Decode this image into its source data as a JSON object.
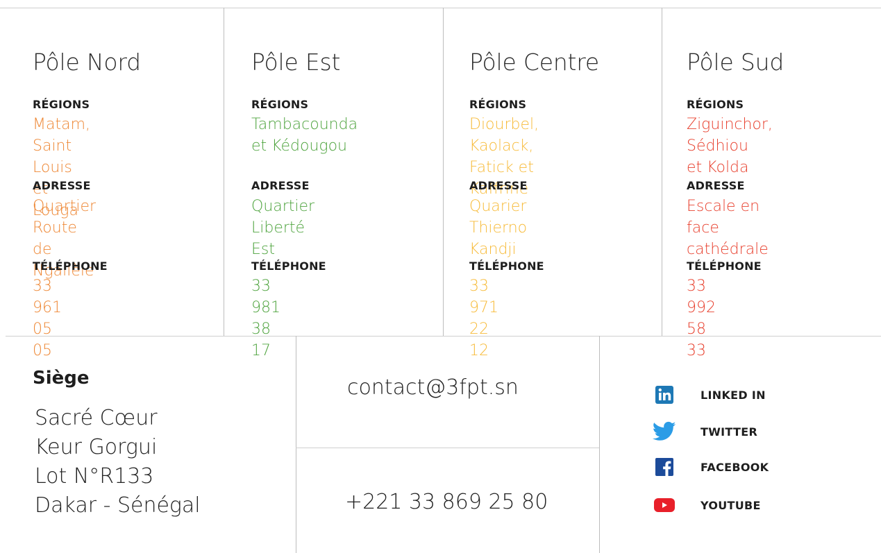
{
  "poles": [
    {
      "title": "Pôle Nord",
      "color": "#ee8836",
      "regions_label": "RÉGIONS",
      "regions": "Matam, Saint Louis\net Louga",
      "adresse_label": "ADRESSE",
      "adresse": "Quartier Route\nde Ngallèle",
      "telephone_label": "TÉLÉPHONE",
      "telephone": "33 961 05 05"
    },
    {
      "title": "Pôle Est",
      "color": "#4fa43f",
      "regions_label": "RÉGIONS",
      "regions": "Tambacounda\net Kédougou",
      "adresse_label": "ADRESSE",
      "adresse": "Quartier Liberté\nEst",
      "telephone_label": "TÉLÉPHONE",
      "telephone": "33 981 38 17"
    },
    {
      "title": "Pôle Centre",
      "color": "#f7bb3a",
      "regions_label": "RÉGIONS",
      "regions": "Diourbel, Kaolack,\nFatick et Kaffrine",
      "adresse_label": "ADRESSE",
      "adresse": "Quarier Thierno\nKandji",
      "telephone_label": "TÉLÉPHONE",
      "telephone": "33 971 22 12"
    },
    {
      "title": "Pôle Sud",
      "color": "#e8412f",
      "regions_label": "RÉGIONS",
      "regions": "Ziguinchor, Sédhiou\net Kolda",
      "adresse_label": "ADRESSE",
      "adresse": "Escale en face\ncathédrale",
      "telephone_label": "TÉLÉPHONE",
      "telephone": "33 992 58 33"
    }
  ],
  "siege": {
    "title": "Siège",
    "lines": [
      "Sacré Cœur",
      "Keur Gorgui",
      "Lot N°R133",
      "Dakar - Sénégal"
    ]
  },
  "contact": {
    "email": "contact@3fpt.sn",
    "phone": "+221 33 869 25 80"
  },
  "social": [
    {
      "label": "LINKED IN",
      "icon": "linkedin-icon",
      "color": "#1d78b5"
    },
    {
      "label": "TWITTER",
      "icon": "twitter-icon",
      "color": "#2b9ce6"
    },
    {
      "label": "FACEBOOK",
      "icon": "facebook-icon",
      "color": "#1c4b9a"
    },
    {
      "label": "YOUTUBE",
      "icon": "youtube-icon",
      "color": "#e8202a"
    }
  ]
}
